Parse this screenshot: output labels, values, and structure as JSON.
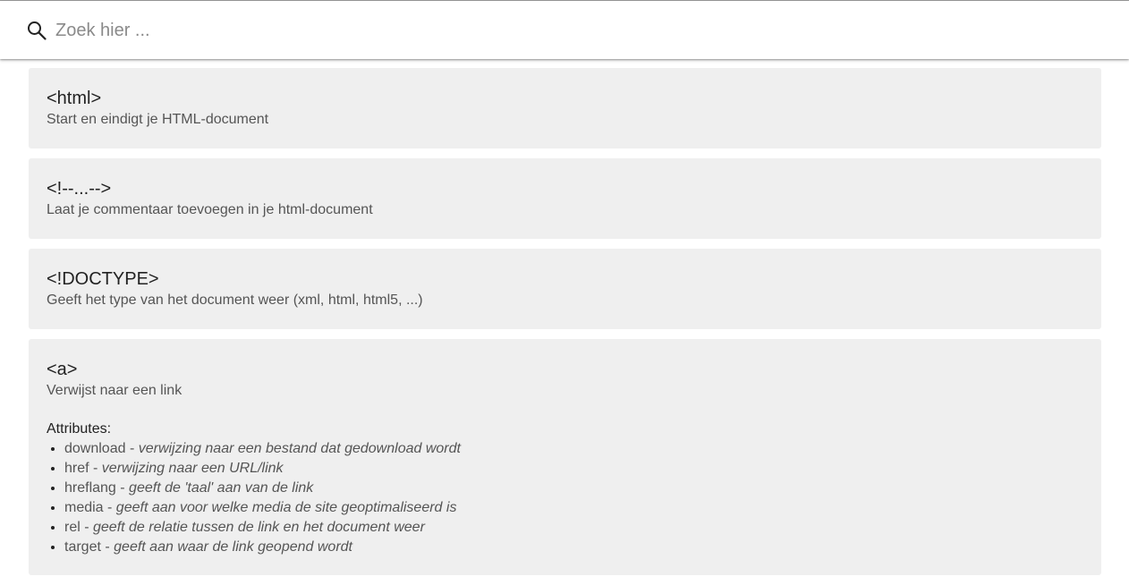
{
  "search": {
    "placeholder": "Zoek hier ...",
    "icon": "search-icon"
  },
  "items": [
    {
      "title": "<html>",
      "description": "Start en eindigt je HTML-document"
    },
    {
      "title": "<!--...-->",
      "description": "Laat je commentaar toevoegen in je html-document"
    },
    {
      "title": "<!DOCTYPE>",
      "description": "Geeft het type van het document weer (xml, html, html5, ...)"
    },
    {
      "title": "<a>",
      "description": "Verwijst naar een link",
      "attributes_heading": "Attributes:",
      "attributes": [
        {
          "name": "download",
          "separator": " - ",
          "desc": "verwijzing naar een bestand dat gedownload wordt"
        },
        {
          "name": "href",
          "separator": " - ",
          "desc": "verwijzing naar een URL/link"
        },
        {
          "name": "hreflang",
          "separator": " - ",
          "desc": "geeft de 'taal' aan van de link"
        },
        {
          "name": "media",
          "separator": " - ",
          "desc": "geeft aan voor welke media de site geoptimaliseerd is"
        },
        {
          "name": "rel",
          "separator": " - ",
          "desc": "geeft de relatie tussen de link en het document weer"
        },
        {
          "name": "target",
          "separator": " - ",
          "desc": "geeft aan waar de link geopend wordt"
        }
      ]
    }
  ]
}
